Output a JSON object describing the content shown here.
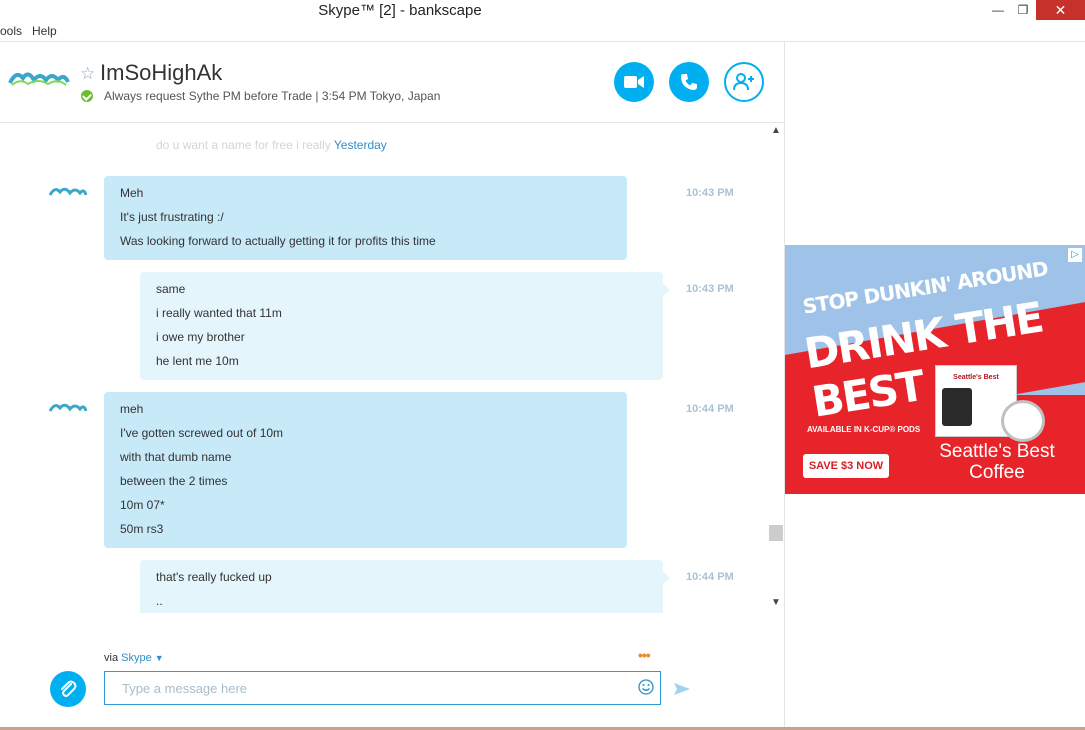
{
  "window": {
    "title": "Skype™ [2] - bankscape",
    "minimize_glyph": "—",
    "maximize_glyph": "❐",
    "close_glyph": "✕"
  },
  "menu": {
    "tools": "ools",
    "help": "Help"
  },
  "header": {
    "contact_name": "ImSoHighAk",
    "mood_message": "Always request Sythe PM before Trade  |  3:54 PM Tokyo, Japan",
    "star_glyph": "☆",
    "buttons": [
      "video-call",
      "voice-call",
      "add-people"
    ]
  },
  "history": {
    "faded_line_1": "",
    "faded_line_2": "do u want a name for free i really ",
    "yesterday_label": "Yesterday"
  },
  "messages": [
    {
      "direction": "in",
      "time": "10:43 PM",
      "lines": [
        "Meh",
        "It's just frustrating :/",
        "Was looking forward to actually getting it for profits this time"
      ]
    },
    {
      "direction": "out",
      "time": "10:43 PM",
      "lines": [
        "same",
        "i really wanted that 11m",
        "i owe my brother",
        "he lent me 10m"
      ]
    },
    {
      "direction": "in",
      "time": "10:44 PM",
      "lines": [
        "meh",
        "I've gotten screwed out of 10m",
        "with that dumb name",
        "between the 2 times",
        "10m 07*",
        "50m rs3"
      ]
    },
    {
      "direction": "out",
      "time": "10:44 PM",
      "lines": [
        "that's really fucked up",
        ".."
      ]
    }
  ],
  "compose": {
    "via_label": "via",
    "via_service": "Skype",
    "placeholder": "Type a message here",
    "typing_indicator": "•••"
  },
  "ad": {
    "line1": "STOP DUNKIN' AROUND",
    "line2": "DRINK THE BEST",
    "availability": "AVAILABLE IN K-CUP® PODS",
    "cta": "SAVE $3 NOW",
    "brand_line1": "Seattle's Best",
    "brand_line2": "Coffee",
    "box_brand": "Seattle's Best",
    "info_glyph": "▷"
  },
  "colors": {
    "accent": "#00aff0",
    "incoming_bubble": "#c7e9f8",
    "outgoing_bubble": "#e5f5fc",
    "ad_red": "#e8242b",
    "ad_sky": "#9fc3e8"
  }
}
